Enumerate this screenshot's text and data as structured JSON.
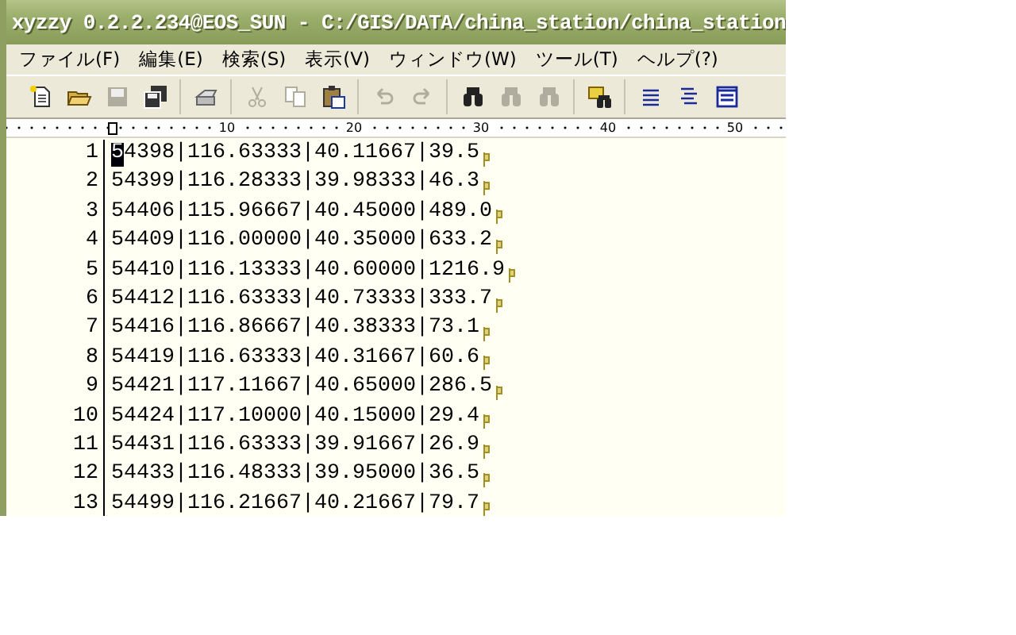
{
  "window": {
    "title": "xyzzy 0.2.2.234@EOS_SUN - C:/GIS/DATA/china_station/china_station"
  },
  "menu": [
    "ファイル(F)",
    "編集(E)",
    "検索(S)",
    "表示(V)",
    "ウィンドウ(W)",
    "ツール(T)",
    "ヘルプ(?)"
  ],
  "toolbar": [
    {
      "buttons": [
        {
          "kind": "new",
          "disabled": false
        },
        {
          "kind": "open",
          "disabled": false
        },
        {
          "kind": "save",
          "disabled": true
        },
        {
          "kind": "save_all",
          "disabled": false
        }
      ]
    },
    {
      "buttons": [
        {
          "kind": "print",
          "disabled": false
        }
      ]
    },
    {
      "buttons": [
        {
          "kind": "cut",
          "disabled": true
        },
        {
          "kind": "copy",
          "disabled": true
        },
        {
          "kind": "paste",
          "disabled": false
        }
      ]
    },
    {
      "buttons": [
        {
          "kind": "undo",
          "disabled": true
        },
        {
          "kind": "redo",
          "disabled": true
        }
      ]
    },
    {
      "buttons": [
        {
          "kind": "find",
          "disabled": false
        },
        {
          "kind": "find_prev",
          "disabled": true
        },
        {
          "kind": "find_next",
          "disabled": true
        }
      ]
    },
    {
      "buttons": [
        {
          "kind": "grep",
          "disabled": false
        }
      ]
    },
    {
      "buttons": [
        {
          "kind": "lines_left",
          "disabled": false
        },
        {
          "kind": "lines_right",
          "disabled": false
        },
        {
          "kind": "window",
          "disabled": false
        }
      ]
    }
  ],
  "ruler": {
    "labels": [
      "10",
      "20",
      "30",
      "40",
      "50"
    ]
  },
  "lines": [
    {
      "number": "1",
      "text": "54398|116.63333|40.11667|39.5",
      "cursor": true
    },
    {
      "number": "2",
      "text": "54399|116.28333|39.98333|46.3",
      "cursor": false
    },
    {
      "number": "3",
      "text": "54406|115.96667|40.45000|489.0",
      "cursor": false
    },
    {
      "number": "4",
      "text": "54409|116.00000|40.35000|633.2",
      "cursor": false
    },
    {
      "number": "5",
      "text": "54410|116.13333|40.60000|1216.9",
      "cursor": false
    },
    {
      "number": "6",
      "text": "54412|116.63333|40.73333|333.7",
      "cursor": false
    },
    {
      "number": "7",
      "text": "54416|116.86667|40.38333|73.1",
      "cursor": false
    },
    {
      "number": "8",
      "text": "54419|116.63333|40.31667|60.6",
      "cursor": false
    },
    {
      "number": "9",
      "text": "54421|117.11667|40.65000|286.5",
      "cursor": false
    },
    {
      "number": "10",
      "text": "54424|117.10000|40.15000|29.4",
      "cursor": false
    },
    {
      "number": "11",
      "text": "54431|116.63333|39.91667|26.9",
      "cursor": false
    },
    {
      "number": "12",
      "text": "54433|116.48333|39.95000|36.5",
      "cursor": false
    },
    {
      "number": "13",
      "text": "54499|116.21667|40.21667|79.7",
      "cursor": false
    }
  ]
}
